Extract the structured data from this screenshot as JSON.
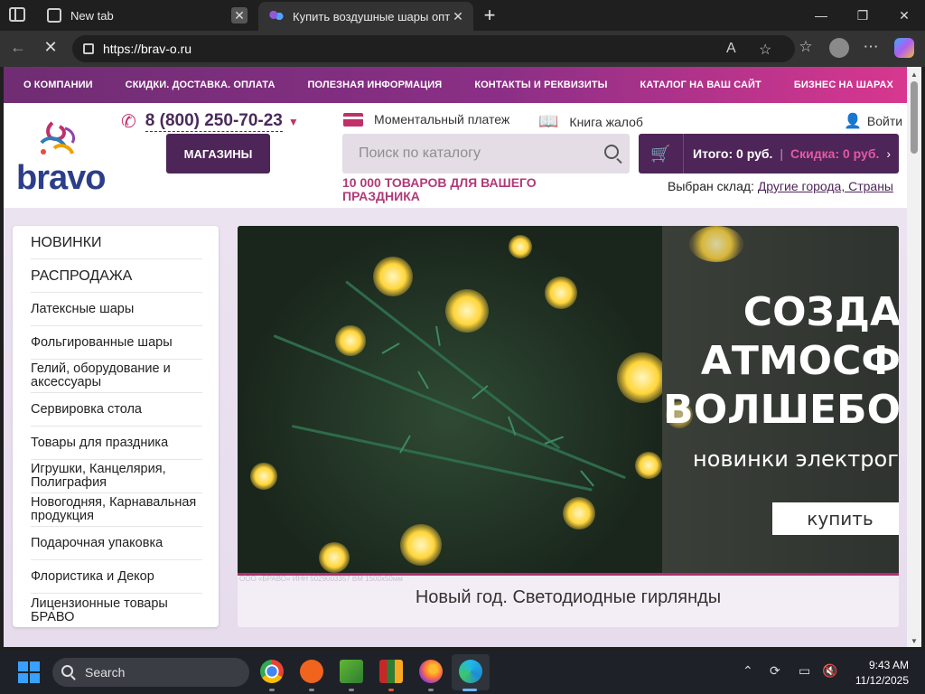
{
  "browser": {
    "tabs": [
      {
        "title": "New tab",
        "close": "✕"
      },
      {
        "title": "Купить воздушные шары оптом",
        "close": "✕"
      }
    ],
    "new_tab": "+",
    "url": "https://brav-o.ru",
    "window_controls": {
      "minimize": "—",
      "restore": "❐",
      "close": "✕"
    }
  },
  "site": {
    "topnav": [
      "О КОМПАНИИ",
      "СКИДКИ. ДОСТАВКА. ОПЛАТА",
      "ПОЛЕЗНАЯ ИНФОРМАЦИЯ",
      "КОНТАКТЫ И РЕКВИЗИТЫ",
      "КАТАЛОГ НА ВАШ САЙТ",
      "БИЗНЕС НА ШАРАХ"
    ],
    "logo_text": "bravo",
    "phone": "8 (800) 250-70-23",
    "shops_button": "МАГАЗИНЫ",
    "instant_payment": "Моментальный платеж",
    "complaints_book": "Книга жалоб",
    "login": "Войти",
    "search_placeholder": "Поиск по каталогу",
    "tagline": "10 000 ТОВАРОВ ДЛЯ ВАШЕГО ПРАЗДНИКА",
    "cart": {
      "total": "Итого: 0 руб.",
      "sep": "|",
      "discount": "Скидка: 0 руб.",
      "arrow": "›"
    },
    "warehouse": {
      "label": "Выбран склад:",
      "value": "Другие города, Страны"
    },
    "sidebar": [
      {
        "label": "НОВИНКИ"
      },
      {
        "label": "РАСПРОДАЖА"
      },
      {
        "label": "Латексные шары"
      },
      {
        "label": "Фольгированные шары"
      },
      {
        "label": "Гелий, оборудование и аксессуары"
      },
      {
        "label": "Сервировка стола"
      },
      {
        "label": "Товары для праздника"
      },
      {
        "label": "Игрушки, Канцелярия, Полиграфия"
      },
      {
        "label": "Новогодняя, Карнавальная продукция"
      },
      {
        "label": "Подарочная упаковка"
      },
      {
        "label": "Флористика и Декор"
      },
      {
        "label": "Лицензионные товары БРАВО"
      }
    ],
    "banner": {
      "headline": [
        "СОЗДА",
        "АТМОСФ",
        "ВОЛШЕБО"
      ],
      "subline": "новинки электрог",
      "buy_button": "купить",
      "fine_print": "ООО «БРАВО» ИНН 5029003357 ВМ 1500х50мм",
      "caption": "Новый год. Светодиодные гирлянды"
    }
  },
  "taskbar": {
    "search": "Search",
    "time": "9:43 AM",
    "date": "11/12/2025"
  },
  "colors": {
    "nav_gradient_start": "#6f2d73",
    "nav_gradient_end": "#d8378f",
    "brand_dark": "#4e2558",
    "accent_pink": "#c0306a"
  }
}
